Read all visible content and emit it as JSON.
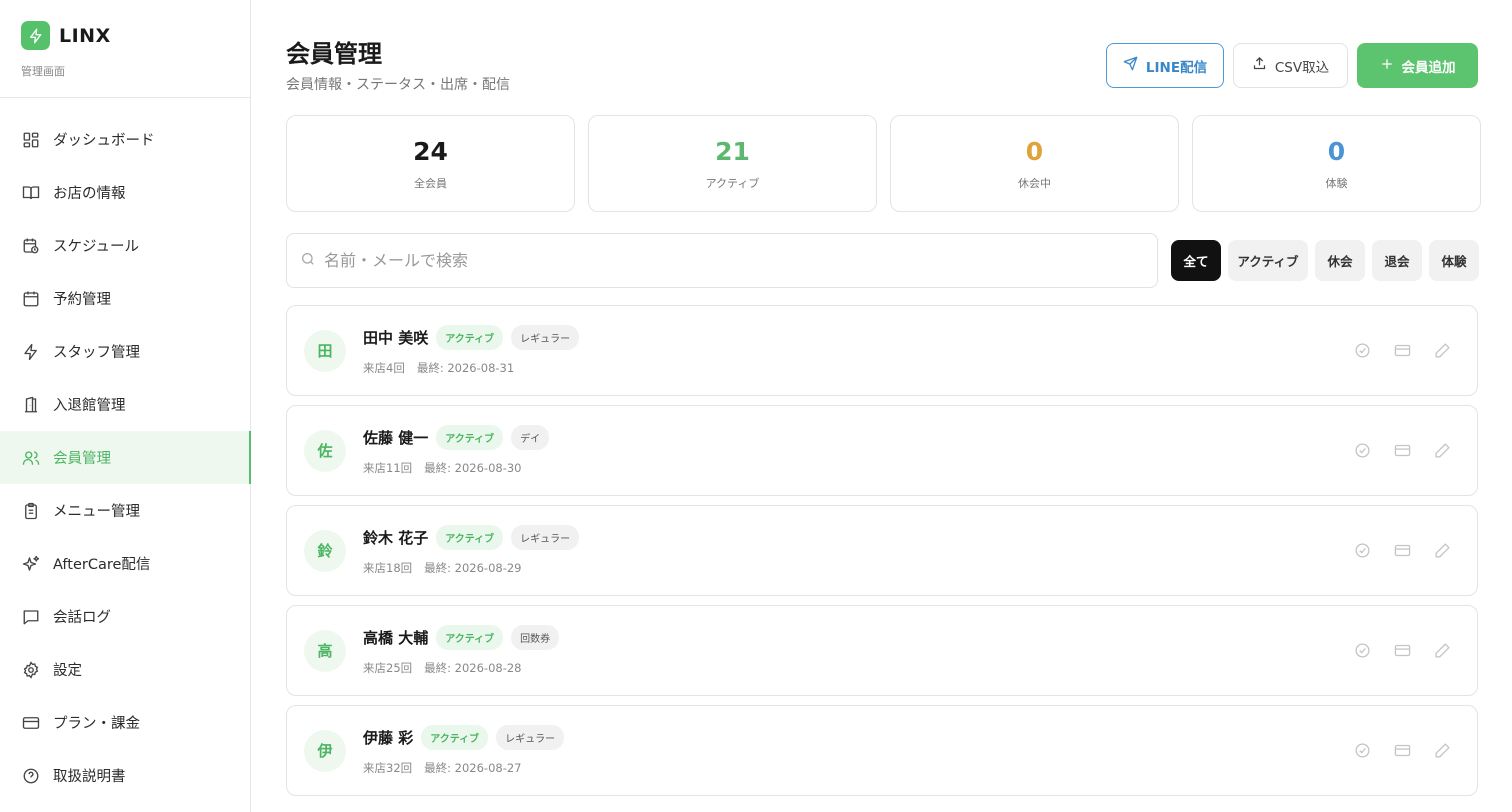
{
  "brand": {
    "name": "LINX",
    "subtitle": "管理画面"
  },
  "sidebar": {
    "items": [
      {
        "label": "ダッシュボード",
        "icon": "dashboard-icon"
      },
      {
        "label": "お店の情報",
        "icon": "book-icon"
      },
      {
        "label": "スケジュール",
        "icon": "calendar-clock-icon"
      },
      {
        "label": "予約管理",
        "icon": "calendar-icon"
      },
      {
        "label": "スタッフ管理",
        "icon": "lightning-icon"
      },
      {
        "label": "入退館管理",
        "icon": "door-icon"
      },
      {
        "label": "会員管理",
        "icon": "users-icon",
        "active": true
      },
      {
        "label": "メニュー管理",
        "icon": "clipboard-icon"
      },
      {
        "label": "AfterCare配信",
        "icon": "sparkles-icon"
      },
      {
        "label": "会話ログ",
        "icon": "chat-icon"
      },
      {
        "label": "設定",
        "icon": "gear-icon"
      },
      {
        "label": "プラン・課金",
        "icon": "card-icon"
      },
      {
        "label": "取扱説明書",
        "icon": "help-icon"
      }
    ]
  },
  "header": {
    "title": "会員管理",
    "subtitle": "会員情報・ステータス・出席・配信",
    "line_button": "LINE配信",
    "csv_button": "CSV取込",
    "add_button": "会員追加"
  },
  "stats": [
    {
      "value": "24",
      "label": "全会員",
      "color": "#1a1a1a"
    },
    {
      "value": "21",
      "label": "アクティブ",
      "color": "#5cb86e"
    },
    {
      "value": "0",
      "label": "休会中",
      "color": "#e0a23a"
    },
    {
      "value": "0",
      "label": "体験",
      "color": "#4a94d6"
    }
  ],
  "search": {
    "placeholder": "名前・メールで検索"
  },
  "filters": [
    "全て",
    "アクティブ",
    "休会",
    "退会",
    "体験"
  ],
  "members": [
    {
      "initial": "田",
      "name": "田中 美咲",
      "status": "アクティブ",
      "plan": "レギュラー",
      "visits": "来店4回",
      "last": "最終: 2026-08-31"
    },
    {
      "initial": "佐",
      "name": "佐藤 健一",
      "status": "アクティブ",
      "plan": "デイ",
      "visits": "来店11回",
      "last": "最終: 2026-08-30"
    },
    {
      "initial": "鈴",
      "name": "鈴木 花子",
      "status": "アクティブ",
      "plan": "レギュラー",
      "visits": "来店18回",
      "last": "最終: 2026-08-29"
    },
    {
      "initial": "高",
      "name": "高橋 大輔",
      "status": "アクティブ",
      "plan": "回数券",
      "visits": "来店25回",
      "last": "最終: 2026-08-28"
    },
    {
      "initial": "伊",
      "name": "伊藤 彩",
      "status": "アクティブ",
      "plan": "レギュラー",
      "visits": "来店32回",
      "last": "最終: 2026-08-27"
    }
  ]
}
